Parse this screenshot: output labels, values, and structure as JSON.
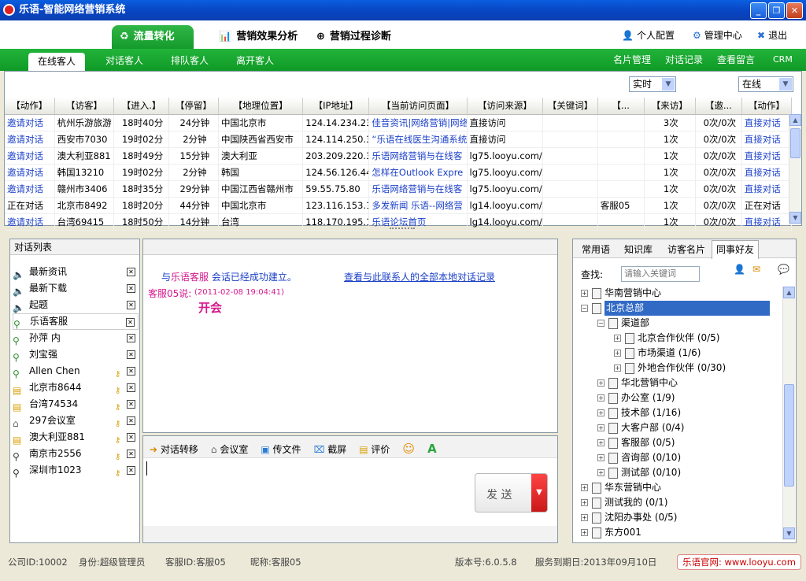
{
  "window": {
    "title": "乐语-智能网络营销系统"
  },
  "top_tabs": [
    "流量转化",
    "营销效果分析",
    "营销过程诊断"
  ],
  "top_links": [
    "个人配置",
    "管理中心",
    "退出"
  ],
  "sub_tabs": [
    "在线客人",
    "对话客人",
    "排队客人",
    "离开客人"
  ],
  "right_links": [
    "名片管理",
    "对话记录",
    "查看留言",
    "CRM"
  ],
  "filters": {
    "time": "实时",
    "status": "在线"
  },
  "table": {
    "headers": [
      "【动作】",
      "【访客】",
      "【进入.】",
      "【停留】",
      "【地理位置】",
      "【IP地址】",
      "【当前访问页面】",
      "【访问来源】",
      "【关键词】",
      "【...",
      "【来访】",
      "【邀...",
      "【动作】"
    ],
    "rows": [
      [
        "邀请对话",
        "杭州乐游旅游",
        "18时40分",
        "24分钟",
        "中国北京市",
        "124.14.234.23",
        "佳音资讯|网络营销|网络",
        "直接访问",
        "",
        "",
        "3次",
        "0次/0次",
        "直接对话"
      ],
      [
        "邀请对话",
        "西安市7030",
        "19时02分",
        "2分钟",
        "中国陕西省西安市",
        "124.114.250.3",
        "“乐语在线医生沟通系统",
        "直接访问",
        "",
        "",
        "1次",
        "0次/0次",
        "直接对话"
      ],
      [
        "邀请对话",
        "澳大利亚881",
        "18时49分",
        "15分钟",
        "澳大利亚",
        "203.209.220.3",
        "乐语网络营销与在线客",
        "lg75.looyu.com/",
        "",
        "",
        "1次",
        "0次/0次",
        "直接对话"
      ],
      [
        "邀请对话",
        "韩国13210",
        "19时02分",
        "2分钟",
        "韩国",
        "124.56.126.44",
        "怎样在Outlook Expre",
        "lg75.looyu.com/",
        "",
        "",
        "1次",
        "0次/0次",
        "直接对话"
      ],
      [
        "邀请对话",
        "赣州市3406",
        "18时35分",
        "29分钟",
        "中国江西省赣州市",
        "59.55.75.80",
        "乐语网络营销与在线客",
        "lg75.looyu.com/",
        "",
        "",
        "1次",
        "0次/0次",
        "直接对话"
      ],
      [
        "正在对话",
        "北京市8492",
        "18时20分",
        "44分钟",
        "中国北京市",
        "123.116.153.1",
        "多发新闻 乐语--网络营",
        "lg14.looyu.com/",
        "",
        "客服05",
        "1次",
        "0次/0次",
        "正在对话"
      ],
      [
        "邀请对话",
        "台湾69415",
        "18时50分",
        "14分钟",
        "台湾",
        "118.170.195.1",
        "乐语论坛首页",
        "lg14.looyu.com/",
        "",
        "",
        "1次",
        "0次/0次",
        "直接对话"
      ]
    ]
  },
  "dialog_list": {
    "title": "对话列表",
    "items": [
      "最新资讯",
      "最新下载",
      "起题",
      "乐语客服",
      "孙萍 内",
      "刘宝强",
      "Allen Chen",
      "北京市8644",
      "台湾74534",
      "297会议室",
      "澳大利亚881",
      "南京市2556",
      "深圳市1023"
    ]
  },
  "chat": {
    "established_prefix": "与",
    "established_name": "乐语客服",
    "established_suffix": "会话已经成功建立。",
    "history_link": "查看与此联系人的全部本地对话记录",
    "sender": "客服05说:",
    "timestamp": "(2011-02-08 19:04:41)",
    "message": "开会"
  },
  "chat_toolbar": [
    "对话转移",
    "会议室",
    "传文件",
    "截屏",
    "评价"
  ],
  "send_button": "发 送",
  "right_tabs": [
    "常用语",
    "知识库",
    "访客名片",
    "同事好友"
  ],
  "search": {
    "label": "查找:",
    "placeholder": "请输入关键词"
  },
  "tree": [
    {
      "label": "华南营销中心",
      "level": 0
    },
    {
      "label": "北京总部",
      "level": 0,
      "selected": true
    },
    {
      "label": "渠道部",
      "level": 1
    },
    {
      "label": "北京合作伙伴 (0/5)",
      "level": 2
    },
    {
      "label": "市场渠道 (1/6)",
      "level": 2
    },
    {
      "label": "外地合作伙伴 (0/30)",
      "level": 2
    },
    {
      "label": "华北营销中心",
      "level": 1
    },
    {
      "label": "办公室 (1/9)",
      "level": 1
    },
    {
      "label": "技术部 (1/16)",
      "level": 1
    },
    {
      "label": "大客户部 (0/4)",
      "level": 1
    },
    {
      "label": "客服部 (0/5)",
      "level": 1
    },
    {
      "label": "咨询部 (0/10)",
      "level": 1
    },
    {
      "label": "测试部 (0/10)",
      "level": 1
    },
    {
      "label": "华东营销中心",
      "level": 0
    },
    {
      "label": "测试我的 (0/1)",
      "level": 0
    },
    {
      "label": "沈阳办事处 (0/5)",
      "level": 0
    },
    {
      "label": "东方001",
      "level": 0
    }
  ],
  "status": {
    "company": "公司ID:10002",
    "role": "身份:超级管理员",
    "agent": "客服ID:客服05",
    "nickname": "昵称:客服05",
    "version": "版本号:6.0.5.8",
    "expiry": "服务到期日:2013年09月10日",
    "site": "乐语官网: www.looyu.com"
  }
}
